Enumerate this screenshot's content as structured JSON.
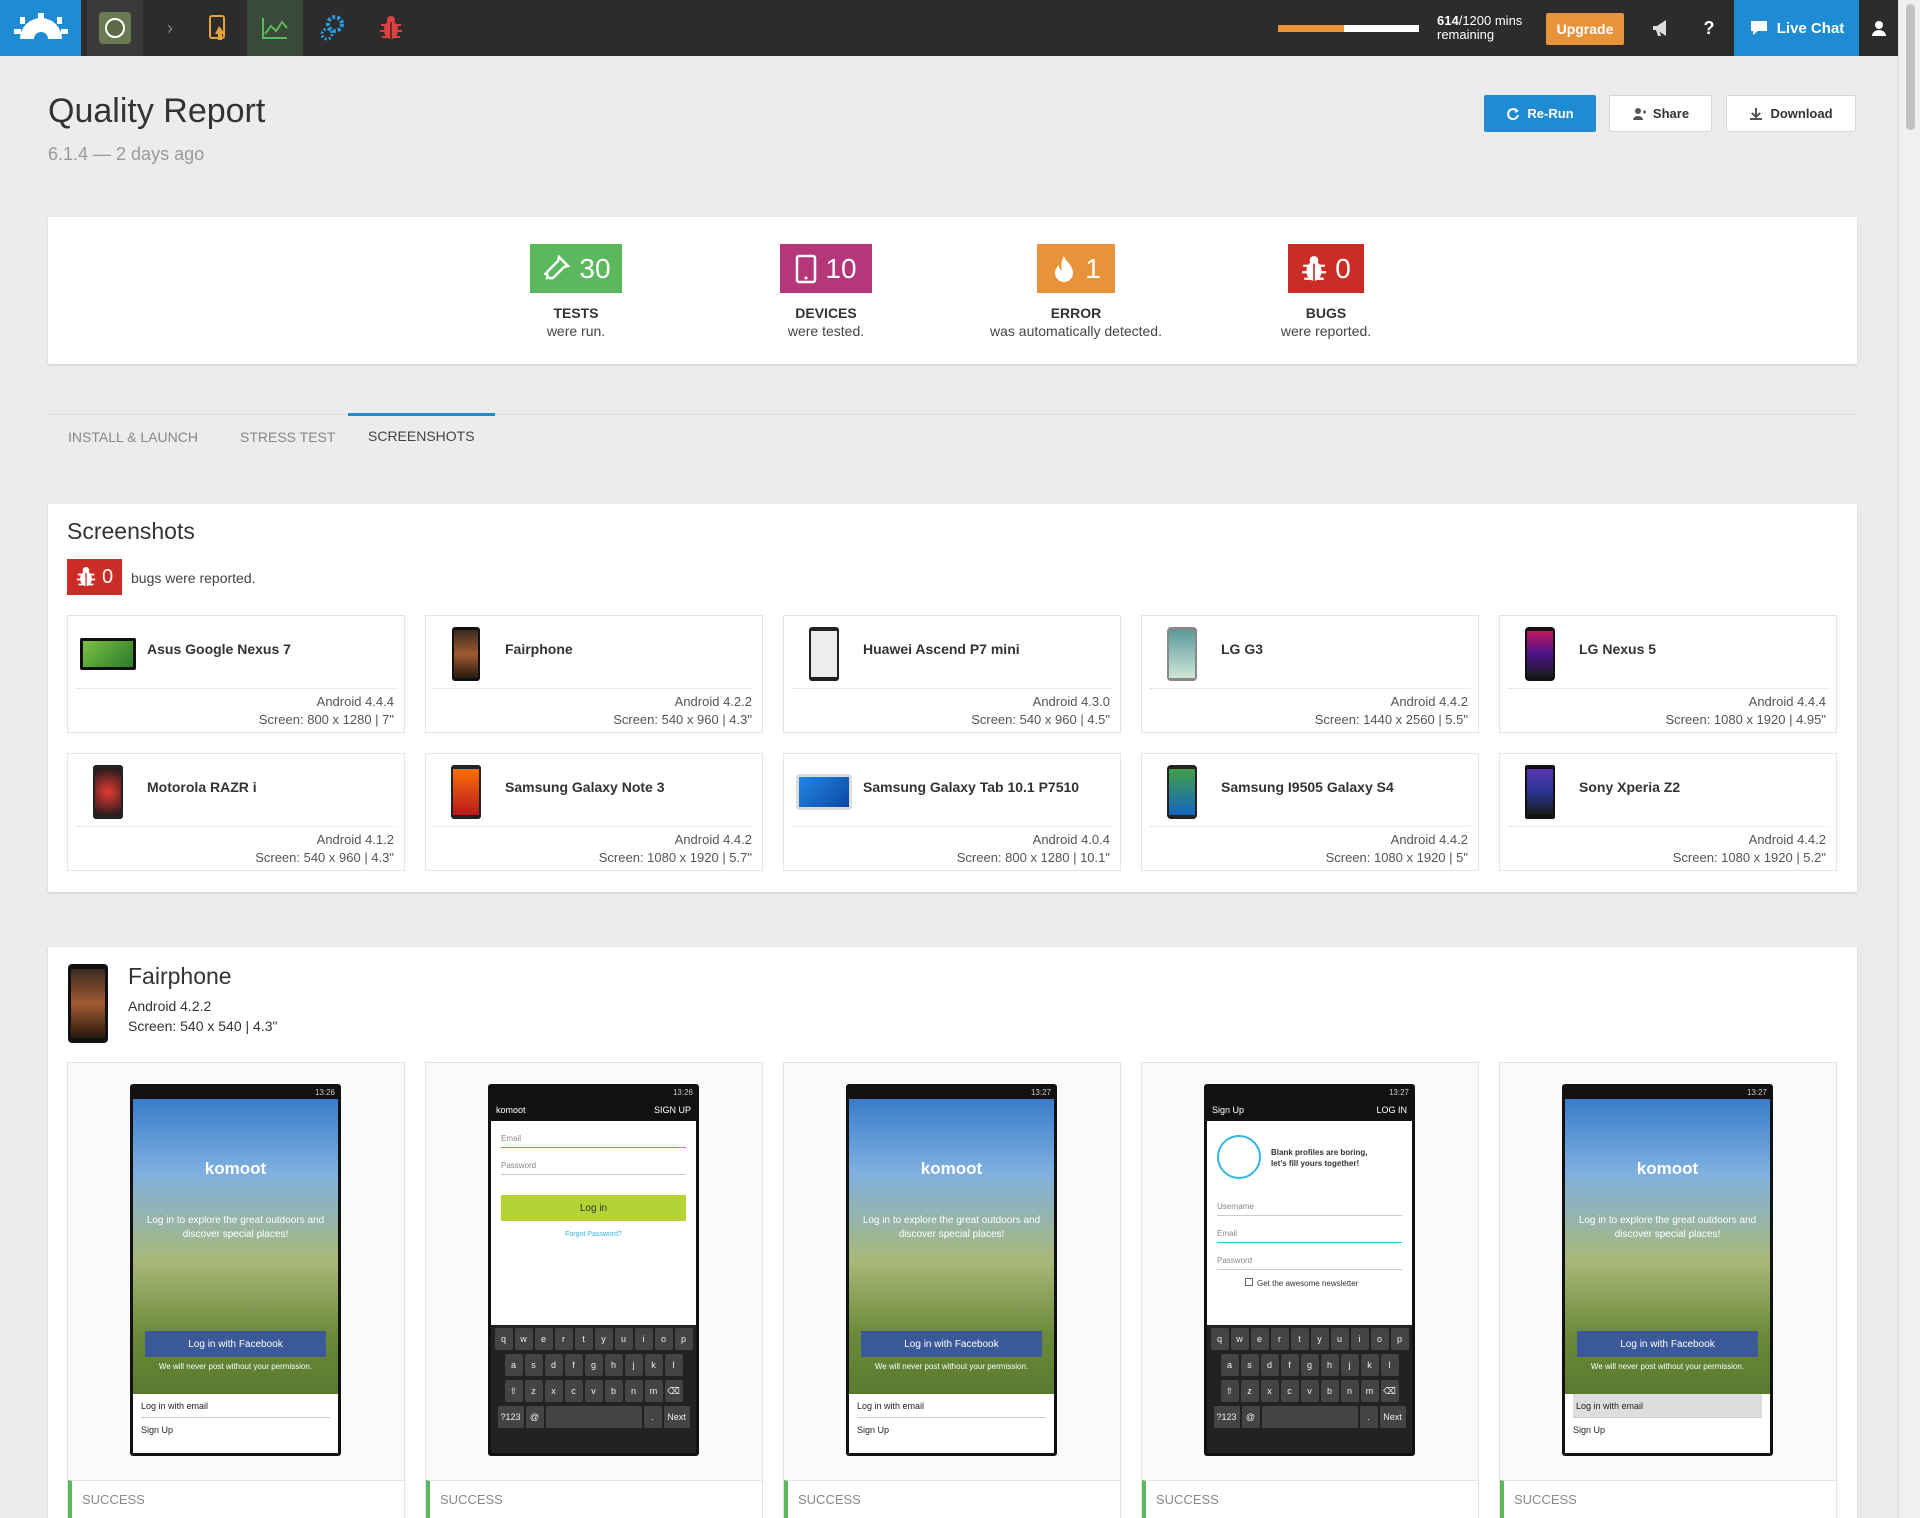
{
  "topbar": {
    "usage": {
      "used": 614,
      "total": 1200,
      "used_fraction": 0.47,
      "used_text": "614",
      "rest_text": "/1200 mins",
      "remaining_label": "remaining"
    },
    "upgrade_label": "Upgrade",
    "live_chat_label": "Live Chat",
    "help_label": "?"
  },
  "page": {
    "title": "Quality Report",
    "subtitle": "6.1.4 — 2 days ago",
    "buttons": {
      "rerun": "Re-Run",
      "share": "Share",
      "download": "Download"
    }
  },
  "summary": [
    {
      "value": "30",
      "label": "TESTS",
      "desc": "were run.",
      "color": "#5cb85c",
      "icon": "flask-icon"
    },
    {
      "value": "10",
      "label": "DEVICES",
      "desc": "were tested.",
      "color": "#b5377a",
      "icon": "tablet-icon"
    },
    {
      "value": "1",
      "label": "ERROR",
      "desc": "was automatically detected.",
      "color": "#e8923a",
      "icon": "fire-icon"
    },
    {
      "value": "0",
      "label": "BUGS",
      "desc": "were reported.",
      "color": "#cc2c26",
      "icon": "bug-icon"
    }
  ],
  "tabs": [
    {
      "label": "INSTALL & LAUNCH",
      "active": false
    },
    {
      "label": "STRESS TEST",
      "active": false
    },
    {
      "label": "SCREENSHOTS",
      "active": true
    }
  ],
  "screenshots": {
    "title": "Screenshots",
    "bugs_count": "0",
    "bugs_text": "bugs were reported.",
    "devices": [
      {
        "name": "Asus Google Nexus 7",
        "os": "Android 4.4.4",
        "screen": "Screen: 800 x 1280 | 7\""
      },
      {
        "name": "Fairphone",
        "os": "Android 4.2.2",
        "screen": "Screen: 540 x 960 | 4.3\""
      },
      {
        "name": "Huawei Ascend P7 mini",
        "os": "Android 4.3.0",
        "screen": "Screen: 540 x 960 | 4.5\""
      },
      {
        "name": "LG G3",
        "os": "Android 4.4.2",
        "screen": "Screen: 1440 x 2560 | 5.5\""
      },
      {
        "name": "LG Nexus 5",
        "os": "Android 4.4.4",
        "screen": "Screen: 1080 x 1920 | 4.95\""
      },
      {
        "name": "Motorola RAZR i",
        "os": "Android 4.1.2",
        "screen": "Screen: 540 x 960 | 4.3\""
      },
      {
        "name": "Samsung Galaxy Note 3",
        "os": "Android 4.4.2",
        "screen": "Screen: 1080 x 1920 | 5.7\""
      },
      {
        "name": "Samsung Galaxy Tab 10.1 P7510",
        "os": "Android 4.0.4",
        "screen": "Screen: 800 x 1280 | 10.1\""
      },
      {
        "name": "Samsung I9505 Galaxy S4",
        "os": "Android 4.4.2",
        "screen": "Screen: 1080 x 1920 | 5\""
      },
      {
        "name": "Sony Xperia Z2",
        "os": "Android 4.4.2",
        "screen": "Screen: 1080 x 1920 | 5.2\""
      }
    ]
  },
  "detail": {
    "name": "Fairphone",
    "os": "Android 4.2.2",
    "screen": "Screen: 540 x 540 | 4.3\"",
    "shots": [
      {
        "time": "13:26",
        "status": "SUCCESS"
      },
      {
        "time": "13:26",
        "status": "SUCCESS"
      },
      {
        "time": "13:27",
        "status": "SUCCESS"
      },
      {
        "time": "13:27",
        "status": "SUCCESS"
      },
      {
        "time": "13:27",
        "status": "SUCCESS"
      }
    ],
    "app": {
      "brand": "komoot",
      "tagline": "Log in to explore the great outdoors and discover special places!",
      "facebook_btn": "Log in with Facebook",
      "facebook_note": "We will never post without your permission.",
      "login_email": "Log in with email",
      "sign_up": "Sign Up",
      "header_signup": "SIGN UP",
      "header_login": "LOG IN",
      "email_placeholder": "Email",
      "password_placeholder": "Password",
      "username_placeholder": "Username",
      "login_btn": "Log in",
      "forgot": "Forgot Password?",
      "profile_blurb_1": "Blank profiles are boring,",
      "profile_blurb_2": "let's fill yours together!",
      "newsletter": "Get the awesome newsletter"
    }
  },
  "colors": {
    "accent": "#1e8bd2",
    "orange": "#e8923a",
    "success": "#5cb85c",
    "danger": "#cc2c26",
    "topbar": "#2c2c2c"
  }
}
